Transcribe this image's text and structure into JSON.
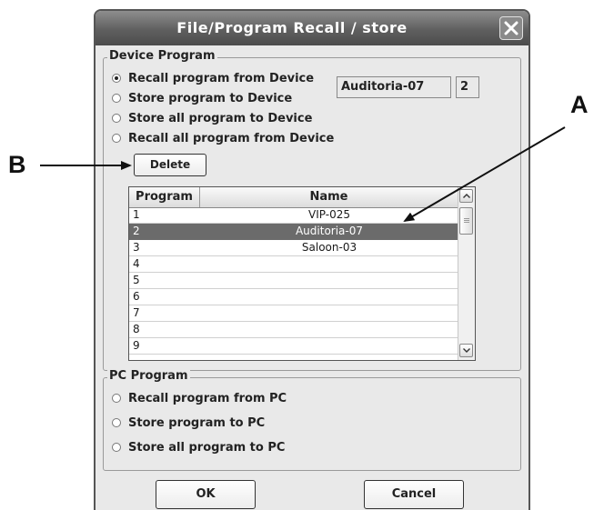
{
  "window": {
    "title": "File/Program Recall / store"
  },
  "device_program": {
    "legend": "Device Program",
    "options": [
      {
        "label": "Recall program from Device",
        "selected": true
      },
      {
        "label": "Store program to Device",
        "selected": false
      },
      {
        "label": "Store all program to Device",
        "selected": false
      },
      {
        "label": "Recall all program from Device",
        "selected": false
      }
    ],
    "name_field": "Auditoria-07",
    "number_field": "2",
    "delete_label": "Delete"
  },
  "program_list": {
    "columns": [
      "Program",
      "Name"
    ],
    "rows": [
      {
        "program": "1",
        "name": "VIP-025"
      },
      {
        "program": "2",
        "name": "Auditoria-07",
        "selected": true
      },
      {
        "program": "3",
        "name": "Saloon-03"
      },
      {
        "program": "4",
        "name": ""
      },
      {
        "program": "5",
        "name": ""
      },
      {
        "program": "6",
        "name": ""
      },
      {
        "program": "7",
        "name": ""
      },
      {
        "program": "8",
        "name": ""
      },
      {
        "program": "9",
        "name": ""
      }
    ]
  },
  "pc_program": {
    "legend": "PC Program",
    "options": [
      {
        "label": "Recall program from PC",
        "selected": false
      },
      {
        "label": "Store program to PC",
        "selected": false
      },
      {
        "label": "Store all program to PC",
        "selected": false
      }
    ]
  },
  "buttons": {
    "ok": "OK",
    "cancel": "Cancel"
  },
  "callouts": {
    "a": "A",
    "b": "B"
  },
  "icons": [
    "close-icon",
    "scroll-up-icon",
    "scroll-down-icon",
    "scroll-grip-icon"
  ],
  "colors": {
    "titlebar": "#5f5f5f",
    "selection": "#6b6b6b",
    "dialog": "#e9e9e9"
  }
}
